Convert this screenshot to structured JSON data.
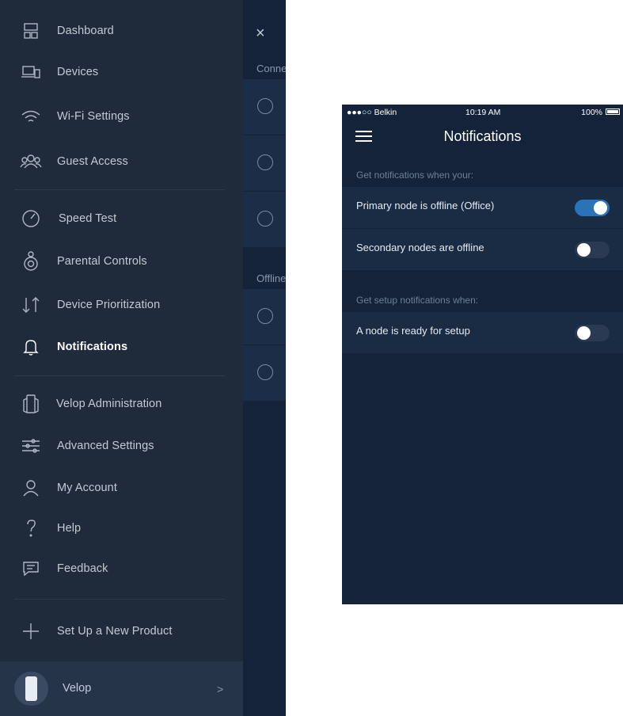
{
  "drawer": {
    "items": [
      {
        "label": "Dashboard",
        "icon": "dashboard-icon"
      },
      {
        "label": "Devices",
        "icon": "devices-icon"
      },
      {
        "label": "Wi-Fi Settings",
        "icon": "wifi-icon"
      },
      {
        "label": "Guest Access",
        "icon": "guest-access-icon"
      },
      {
        "label": "Speed Test",
        "icon": "speed-test-icon"
      },
      {
        "label": "Parental Controls",
        "icon": "parental-controls-icon"
      },
      {
        "label": "Device Prioritization",
        "icon": "prioritization-arrows-icon"
      },
      {
        "label": "Notifications",
        "icon": "bell-icon",
        "active": true
      },
      {
        "label": "Velop Administration",
        "icon": "velop-node-icon"
      },
      {
        "label": "Advanced Settings",
        "icon": "sliders-icon"
      },
      {
        "label": "My Account",
        "icon": "user-icon"
      },
      {
        "label": "Help",
        "icon": "question-icon"
      },
      {
        "label": "Feedback",
        "icon": "chat-bubble-icon"
      },
      {
        "label": "Set Up a New Product",
        "icon": "plus-icon"
      }
    ],
    "footer": {
      "name": "Velop",
      "icon": "velop-node-icon"
    }
  },
  "underlay": {
    "close_glyph": "×",
    "section_connected": "Conne",
    "section_offline": "Offline"
  },
  "phone": {
    "status": {
      "carrier": "●●●○○ Belkin",
      "time": "10:19 AM",
      "battery": "100%"
    },
    "title": "Notifications",
    "hint1": "Get notifications when your:",
    "hint2": "Get setup notifications when:",
    "settings": [
      {
        "label": "Primary node is offline (Office)",
        "on": true
      },
      {
        "label": "Secondary nodes are offline",
        "on": false
      },
      {
        "label": "A node is ready for setup",
        "on": false
      }
    ]
  },
  "colors": {
    "drawer_bg": "#1f2a3a",
    "screen_bg": "#14233a",
    "toggle_on": "#2b73b8"
  }
}
